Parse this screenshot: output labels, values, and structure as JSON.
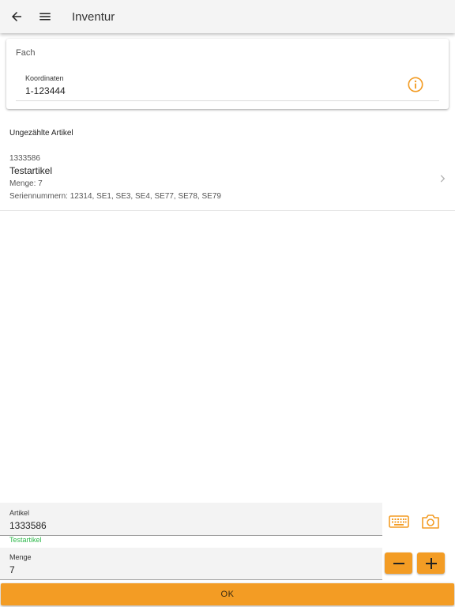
{
  "appbar": {
    "title": "Inventur",
    "back_icon": "arrow-left-icon",
    "menu_icon": "hamburger-menu-icon"
  },
  "fach_card": {
    "title": "Fach",
    "field_label": "Koordinaten",
    "field_value": "1-123444",
    "info_icon": "info-circle-icon"
  },
  "section": {
    "title": "Ungezählte Artikel"
  },
  "items": [
    {
      "number": "1333586",
      "name": "Testartikel",
      "quantity": "Menge: 7",
      "serials": "Seriennummern: 12314, SE1, SE3, SE4, SE77, SE78, SE79"
    }
  ],
  "form": {
    "artikel_label": "Artikel",
    "artikel_value": "1333586",
    "artikel_hint": "Testartikel",
    "menge_label": "Menge",
    "menge_value": "7",
    "keyboard_icon": "keyboard-icon",
    "camera_icon": "camera-icon",
    "minus_icon": "minus-icon",
    "plus_icon": "plus-icon",
    "ok_label": "OK"
  },
  "colors": {
    "accent": "#f39c24",
    "hint_green": "#2eb84b",
    "appbar_bg": "#f4f4f4"
  }
}
